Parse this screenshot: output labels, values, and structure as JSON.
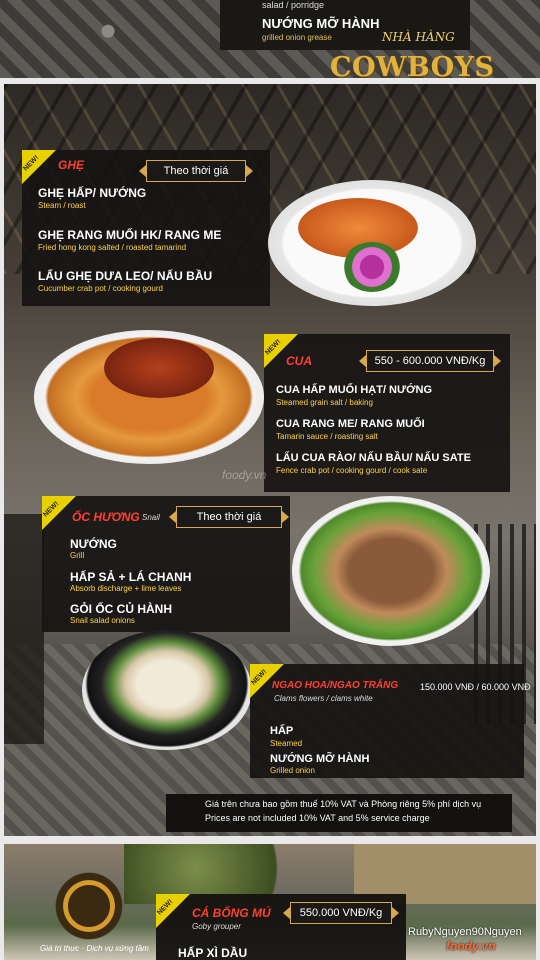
{
  "top_section": {
    "line1": "salad / porridge",
    "item": "NƯỚNG MỠ HÀNH",
    "item_sub": "grilled onion grease"
  },
  "logo": {
    "pre": "NHÀ HÀNG",
    "name": "COWBOYS"
  },
  "new_label": "NEW!",
  "sections": {
    "ghe": {
      "title": "GHẸ",
      "price": "Theo thời giá",
      "items": [
        {
          "name": "GHẸ HẤP/ NƯỚNG",
          "desc": "Steam / roast"
        },
        {
          "name": "GHẸ RANG MUỐI HK/ RANG ME",
          "desc": "Fried hong kong salted / roasted tamarind"
        },
        {
          "name": "LẨU GHẸ DƯA LEO/ NẤU BẦU",
          "desc": "Cucumber crab pot / cooking gourd"
        }
      ]
    },
    "cua": {
      "title": "CUA",
      "price": "550 - 600.000 VNĐ/Kg",
      "items": [
        {
          "name": "CUA HẤP MUỐI HẠT/ NƯỚNG",
          "desc": "Steamed grain salt / baking"
        },
        {
          "name": "CUA RANG ME/ RANG MUỐI",
          "desc": "Tamarin sauce / roasting salt"
        },
        {
          "name": "LẨU CUA RÀO/ NẤU BẦU/ NẤU SATE",
          "desc": "Fence crab pot / cooking gourd / cook sate"
        }
      ]
    },
    "oc_huong": {
      "title": "ỐC HƯƠNG",
      "title_sub": "Snail",
      "price": "Theo thời giá",
      "items": [
        {
          "name": "NƯỚNG",
          "desc": "Grill"
        },
        {
          "name": "HẤP SẢ + LÁ CHANH",
          "desc": "Absorb discharge + lime leaves"
        },
        {
          "name": "GỎI ỐC CỦ HÀNH",
          "desc": "Snail salad onions"
        }
      ]
    },
    "ngao": {
      "title": "NGAO HOA/NGAO TRẮNG",
      "title_sub": "Clams flowers / clams white",
      "price": "150.000 VNĐ / 60.000 VNĐ",
      "items": [
        {
          "name": "HẤP",
          "desc": "Steamed"
        },
        {
          "name": "NƯỚNG MỠ HÀNH",
          "desc": "Grilled onion"
        }
      ]
    }
  },
  "note": {
    "vn": "Giá trên chưa bao gồm thuế 10% VAT và Phòng riêng 5% phí dịch vụ",
    "en": "Prices are not included 10% VAT and 5% service charge"
  },
  "watermark_center": "foody.vn",
  "bottom": {
    "logo_tagline": "Giá trị thực · Dịch vụ xứng tầm",
    "title": "CÁ BỐNG MÚ",
    "title_sub": "Goby grouper",
    "price": "550.000 VNĐ/Kg",
    "item": "HẤP XÌ DẦU",
    "watermark_user": "RubyNguyen90Nguyen",
    "watermark_brand": "foody.vn"
  }
}
